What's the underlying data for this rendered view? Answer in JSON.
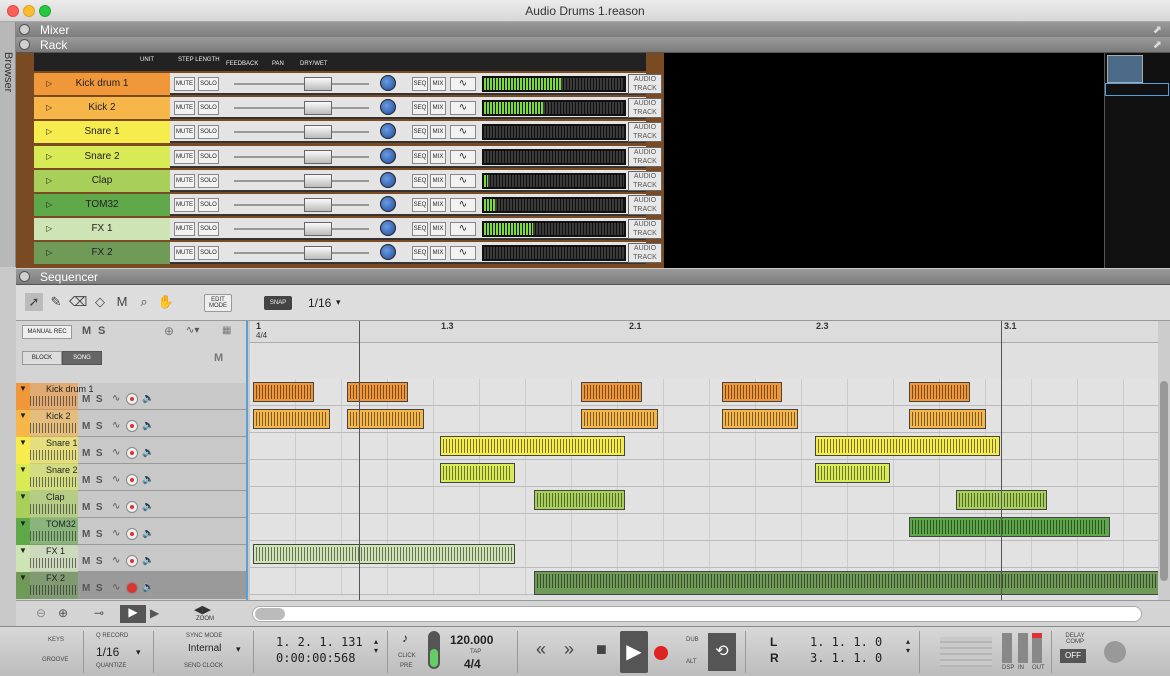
{
  "window": {
    "title": "Audio Drums 1.reason"
  },
  "browser": {
    "label": "Browser"
  },
  "sections": {
    "mixer": "Mixer",
    "rack": "Rack",
    "sequencer": "Sequencer"
  },
  "rack": {
    "top_labels": {
      "unit": "UNIT",
      "step_length": "STEP LENGTH",
      "feedback": "FEEDBACK",
      "pan": "PAN",
      "dry_wet": "DRY/WET"
    },
    "mute_label": "MUTE",
    "solo_label": "SOLO",
    "seq_label": "SEQ",
    "mix_label": "MIX",
    "audio_track_label": "AUDIO TRACK",
    "channels": [
      {
        "name": "Kick drum 1",
        "color": "#f0973a",
        "level": 0.55
      },
      {
        "name": "Kick 2",
        "color": "#f6b64a",
        "level": 0.42
      },
      {
        "name": "Snare 1",
        "color": "#f7ec4e",
        "level": 0.0
      },
      {
        "name": "Snare 2",
        "color": "#d8ea55",
        "level": 0.0
      },
      {
        "name": "Clap",
        "color": "#a8cf5a",
        "level": 0.03
      },
      {
        "name": "TOM32",
        "color": "#5fa84a",
        "level": 0.08
      },
      {
        "name": "FX 1",
        "color": "#cfe4b5",
        "level": 0.35
      },
      {
        "name": "FX 2",
        "color": "#6f9a58",
        "level": 0.0
      }
    ]
  },
  "sequencer": {
    "edit_mode": "EDIT MODE",
    "snap": "SNAP",
    "snap_value": "1/16",
    "manual_rec": "MANUAL REC",
    "m": "M",
    "s": "S",
    "block": "BLOCK",
    "song": "SONG",
    "ruler": [
      {
        "label": "1",
        "sub": "4/4"
      },
      {
        "label": "1.3"
      },
      {
        "label": "2.1"
      },
      {
        "label": "2.3"
      },
      {
        "label": "3.1"
      }
    ],
    "tracks": [
      "Kick drum 1",
      "Kick 2",
      "Snare 1",
      "Snare 2",
      "Clap",
      "TOM32",
      "FX 1",
      "FX 2"
    ],
    "zoom_label": "ZOOM"
  },
  "transport": {
    "keys": "KEYS",
    "groove": "GROOVE",
    "q_record": "Q RECORD",
    "quantize_value": "1/16",
    "quantize": "QUANTIZE",
    "sync_mode": "SYNC MODE",
    "sync_value": "Internal",
    "send_clock": "SEND CLOCK",
    "position_bars": "1.  2.  1. 131",
    "position_time": "0:00:00:568",
    "click": "CLICK",
    "pre": "PRE",
    "tempo": "120.000",
    "tap": "TAP",
    "signature": "4/4",
    "dub": "DUB",
    "alt": "ALT",
    "loop_l_label": "L",
    "loop_r_label": "R",
    "loop_l": "1.  1.  1.     0",
    "loop_r": "3.  1.  1.     0",
    "dsp": "DSP",
    "in": "IN",
    "out": "OUT",
    "delay_comp": "DELAY COMP",
    "delay_comp_value": "OFF"
  }
}
